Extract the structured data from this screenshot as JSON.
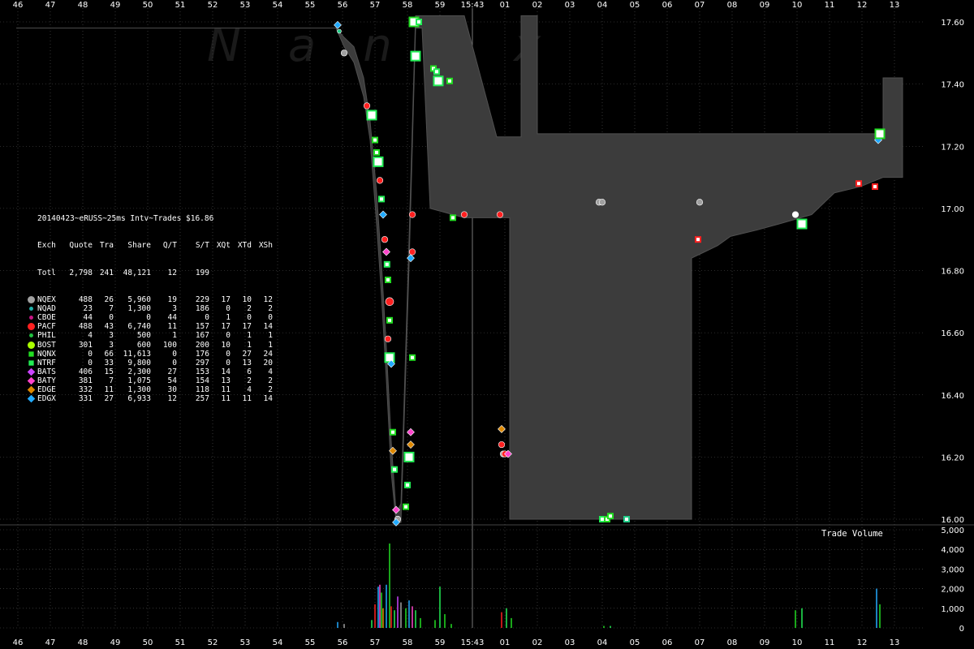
{
  "chart_data": {
    "type": "scatter",
    "title": "20140423~eRUSS~25ms Intv~Trades $16.86",
    "x_ticks_top": [
      "46",
      "47",
      "48",
      "49",
      "50",
      "51",
      "52",
      "53",
      "54",
      "55",
      "56",
      "57",
      "58",
      "59",
      "15:43",
      "01",
      "02",
      "03",
      "04",
      "05",
      "06",
      "07",
      "08",
      "09",
      "10",
      "11",
      "12",
      "13"
    ],
    "x_ticks_bottom": [
      "46",
      "47",
      "48",
      "49",
      "50",
      "51",
      "52",
      "53",
      "54",
      "55",
      "56",
      "57",
      "58",
      "59",
      "15:43",
      "01",
      "02",
      "03",
      "04",
      "05",
      "06",
      "07",
      "08",
      "09",
      "10",
      "11",
      "12",
      "13"
    ],
    "y_ticks": [
      "17.60",
      "17.40",
      "17.20",
      "17.00",
      "16.80",
      "16.60",
      "16.40",
      "16.20",
      "16.00"
    ],
    "ylim": [
      16.0,
      17.6
    ],
    "volume_ticks": [
      "5,000",
      "4,000",
      "3,000",
      "2,000",
      "1,000",
      "0"
    ],
    "volume_ylim": [
      0,
      5000
    ],
    "volume_title": "Trade Volume",
    "grid": true,
    "watermark": "Nanex",
    "legend": {
      "placement": "left",
      "header": [
        "Exch",
        "Quote",
        "Tra",
        "Share",
        "Q/T",
        "S/T",
        "XQt",
        "XTd",
        "XSh"
      ],
      "total": [
        "Totl",
        "2,798",
        "241",
        "48,121",
        "12",
        "199",
        "",
        "",
        ""
      ],
      "rows": [
        {
          "exch": "NQEX",
          "quote": "488",
          "tra": "26",
          "share": "5,960",
          "qt": "19",
          "st": "229",
          "xqt": "17",
          "xtd": "10",
          "xsh": "12",
          "color": "#a0a0a0",
          "shape": "circle-big"
        },
        {
          "exch": "NQAD",
          "quote": "23",
          "tra": "7",
          "share": "1,300",
          "qt": "3",
          "st": "186",
          "xqt": "0",
          "xtd": "2",
          "xsh": "2",
          "color": "#20b2aa",
          "shape": "dot"
        },
        {
          "exch": "CBOE",
          "quote": "44",
          "tra": "0",
          "share": "0",
          "qt": "44",
          "st": "0",
          "xqt": "1",
          "xtd": "0",
          "xsh": "0",
          "color": "#c71585",
          "shape": "dot"
        },
        {
          "exch": "PACF",
          "quote": "488",
          "tra": "43",
          "share": "6,740",
          "qt": "11",
          "st": "157",
          "xqt": "17",
          "xtd": "17",
          "xsh": "14",
          "color": "#ff2020",
          "shape": "circle-big"
        },
        {
          "exch": "PHIL",
          "quote": "4",
          "tra": "3",
          "share": "500",
          "qt": "1",
          "st": "167",
          "xqt": "0",
          "xtd": "1",
          "xsh": "1",
          "color": "#20c040",
          "shape": "dot"
        },
        {
          "exch": "BOST",
          "quote": "301",
          "tra": "3",
          "share": "600",
          "qt": "100",
          "st": "200",
          "xqt": "10",
          "xtd": "1",
          "xsh": "1",
          "color": "#aaff00",
          "shape": "circle-big"
        },
        {
          "exch": "NQNX",
          "quote": "0",
          "tra": "66",
          "share": "11,613",
          "qt": "0",
          "st": "176",
          "xqt": "0",
          "xtd": "27",
          "xsh": "24",
          "color": "#22dd22",
          "shape": "square"
        },
        {
          "exch": "NTRF",
          "quote": "0",
          "tra": "33",
          "share": "9,800",
          "qt": "0",
          "st": "297",
          "xqt": "0",
          "xtd": "13",
          "xsh": "20",
          "color": "#22ee55",
          "shape": "square"
        },
        {
          "exch": "BATS",
          "quote": "406",
          "tra": "15",
          "share": "2,300",
          "qt": "27",
          "st": "153",
          "xqt": "14",
          "xtd": "6",
          "xsh": "4",
          "color": "#cc44ff",
          "shape": "diamond"
        },
        {
          "exch": "BATY",
          "quote": "381",
          "tra": "7",
          "share": "1,075",
          "qt": "54",
          "st": "154",
          "xqt": "13",
          "xtd": "2",
          "xsh": "2",
          "color": "#ff44cc",
          "shape": "diamond"
        },
        {
          "exch": "EDGE",
          "quote": "332",
          "tra": "11",
          "share": "1,300",
          "qt": "30",
          "st": "118",
          "xqt": "11",
          "xtd": "4",
          "xsh": "2",
          "color": "#dd8800",
          "shape": "diamond"
        },
        {
          "exch": "EDGX",
          "quote": "331",
          "tra": "27",
          "share": "6,933",
          "qt": "12",
          "st": "257",
          "xqt": "11",
          "xtd": "11",
          "xsh": "14",
          "color": "#22aaff",
          "shape": "diamond"
        }
      ]
    },
    "nbbo_band": [
      {
        "t": 0.0,
        "bid": 17.58,
        "ask": 17.58
      },
      {
        "t": 9.85,
        "bid": 17.58,
        "ask": 17.58
      },
      {
        "t": 10.1,
        "bid": 17.52,
        "ask": 17.55
      },
      {
        "t": 10.4,
        "bid": 17.47,
        "ask": 17.52
      },
      {
        "t": 10.7,
        "bid": 17.36,
        "ask": 17.42
      },
      {
        "t": 10.9,
        "bid": 17.22,
        "ask": 17.28
      },
      {
        "t": 11.1,
        "bid": 16.95,
        "ask": 17.05
      },
      {
        "t": 11.25,
        "bid": 16.72,
        "ask": 16.82
      },
      {
        "t": 11.4,
        "bid": 16.45,
        "ask": 16.55
      },
      {
        "t": 11.55,
        "bid": 16.15,
        "ask": 16.25
      },
      {
        "t": 11.7,
        "bid": 15.99,
        "ask": 16.02
      },
      {
        "t": 11.85,
        "bid": 15.99,
        "ask": 16.05
      },
      {
        "t": 12.1,
        "bid": 16.82,
        "ask": 16.9
      },
      {
        "t": 12.3,
        "bid": 17.58,
        "ask": 17.62
      },
      {
        "t": 12.5,
        "bid": 17.58,
        "ask": 17.62
      },
      {
        "t": 12.75,
        "bid": 17.0,
        "ask": 17.62
      },
      {
        "t": 13.8,
        "bid": 16.97,
        "ask": 17.62
      },
      {
        "t": 14.8,
        "bid": 16.97,
        "ask": 17.23
      },
      {
        "t": 15.2,
        "bid": 16.97,
        "ask": 17.23
      },
      {
        "t": 15.2,
        "bid": 16.0,
        "ask": 17.23
      },
      {
        "t": 15.55,
        "bid": 16.0,
        "ask": 17.23
      },
      {
        "t": 15.55,
        "bid": 16.0,
        "ask": 17.62
      },
      {
        "t": 16.05,
        "bid": 16.0,
        "ask": 17.62
      },
      {
        "t": 16.05,
        "bid": 16.0,
        "ask": 17.24
      },
      {
        "t": 20.8,
        "bid": 16.0,
        "ask": 17.24
      },
      {
        "t": 20.8,
        "bid": 16.84,
        "ask": 17.24
      },
      {
        "t": 21.2,
        "bid": 16.86,
        "ask": 17.24
      },
      {
        "t": 21.6,
        "bid": 16.88,
        "ask": 17.24
      },
      {
        "t": 22.0,
        "bid": 16.91,
        "ask": 17.24
      },
      {
        "t": 22.8,
        "bid": 16.93,
        "ask": 17.24
      },
      {
        "t": 23.5,
        "bid": 16.95,
        "ask": 17.24
      },
      {
        "t": 24.5,
        "bid": 16.98,
        "ask": 17.24
      },
      {
        "t": 25.2,
        "bid": 17.05,
        "ask": 17.24
      },
      {
        "t": 26.0,
        "bid": 17.07,
        "ask": 17.24
      },
      {
        "t": 26.7,
        "bid": 17.1,
        "ask": 17.24
      },
      {
        "t": 26.7,
        "bid": 17.1,
        "ask": 17.42
      },
      {
        "t": 27.3,
        "bid": 17.1,
        "ask": 17.42
      }
    ],
    "trades": [
      {
        "x": 9.9,
        "y": 17.59,
        "c": "#22aaff",
        "s": "diamond"
      },
      {
        "x": 9.95,
        "y": 17.57,
        "c": "#22cc88",
        "s": "dot"
      },
      {
        "x": 10.1,
        "y": 17.5,
        "c": "#a0a0a0",
        "s": "circle"
      },
      {
        "x": 10.8,
        "y": 17.33,
        "c": "#ff2020",
        "s": "circle"
      },
      {
        "x": 10.95,
        "y": 17.3,
        "c": "#22ee55",
        "s": "square-big"
      },
      {
        "x": 11.05,
        "y": 17.22,
        "c": "#22dd22",
        "s": "square"
      },
      {
        "x": 11.1,
        "y": 17.18,
        "c": "#22dd22",
        "s": "square"
      },
      {
        "x": 11.15,
        "y": 17.15,
        "c": "#22ee55",
        "s": "square-big"
      },
      {
        "x": 11.2,
        "y": 17.09,
        "c": "#ff2020",
        "s": "circle"
      },
      {
        "x": 11.25,
        "y": 17.03,
        "c": "#22ee55",
        "s": "square"
      },
      {
        "x": 11.3,
        "y": 16.98,
        "c": "#22aaff",
        "s": "diamond"
      },
      {
        "x": 11.35,
        "y": 16.9,
        "c": "#ff2020",
        "s": "circle"
      },
      {
        "x": 11.4,
        "y": 16.86,
        "c": "#ff44cc",
        "s": "diamond"
      },
      {
        "x": 11.42,
        "y": 16.82,
        "c": "#22ee55",
        "s": "square"
      },
      {
        "x": 11.45,
        "y": 16.77,
        "c": "#22dd22",
        "s": "square"
      },
      {
        "x": 11.5,
        "y": 16.7,
        "c": "#ff2020",
        "s": "circle-big"
      },
      {
        "x": 11.5,
        "y": 16.64,
        "c": "#22dd22",
        "s": "square"
      },
      {
        "x": 11.45,
        "y": 16.58,
        "c": "#ff2020",
        "s": "circle"
      },
      {
        "x": 11.5,
        "y": 16.52,
        "c": "#22ee55",
        "s": "square-big"
      },
      {
        "x": 11.55,
        "y": 16.5,
        "c": "#22aaff",
        "s": "diamond"
      },
      {
        "x": 11.6,
        "y": 16.28,
        "c": "#22dd22",
        "s": "square"
      },
      {
        "x": 11.6,
        "y": 16.22,
        "c": "#dd8800",
        "s": "diamond"
      },
      {
        "x": 11.65,
        "y": 16.16,
        "c": "#22ee55",
        "s": "square"
      },
      {
        "x": 11.7,
        "y": 16.03,
        "c": "#ff44cc",
        "s": "diamond"
      },
      {
        "x": 11.75,
        "y": 16.0,
        "c": "#a0a0a0",
        "s": "circle"
      },
      {
        "x": 11.7,
        "y": 15.99,
        "c": "#22aaff",
        "s": "diamond"
      },
      {
        "x": 12.0,
        "y": 16.04,
        "c": "#22dd22",
        "s": "square"
      },
      {
        "x": 12.05,
        "y": 16.11,
        "c": "#22ee55",
        "s": "square"
      },
      {
        "x": 12.1,
        "y": 16.2,
        "c": "#22ee55",
        "s": "square-big"
      },
      {
        "x": 12.15,
        "y": 16.24,
        "c": "#dd8800",
        "s": "diamond"
      },
      {
        "x": 12.15,
        "y": 16.28,
        "c": "#ff44cc",
        "s": "diamond"
      },
      {
        "x": 12.2,
        "y": 16.52,
        "c": "#22dd22",
        "s": "square"
      },
      {
        "x": 12.15,
        "y": 16.84,
        "c": "#22aaff",
        "s": "diamond"
      },
      {
        "x": 12.2,
        "y": 16.86,
        "c": "#ff2020",
        "s": "circle"
      },
      {
        "x": 12.2,
        "y": 16.98,
        "c": "#ff2020",
        "s": "circle"
      },
      {
        "x": 12.3,
        "y": 17.49,
        "c": "#22ee55",
        "s": "square-big"
      },
      {
        "x": 12.25,
        "y": 17.6,
        "c": "#22dd22",
        "s": "square-big"
      },
      {
        "x": 12.4,
        "y": 17.6,
        "c": "#22ee55",
        "s": "square"
      },
      {
        "x": 12.85,
        "y": 17.45,
        "c": "#22dd22",
        "s": "square"
      },
      {
        "x": 12.95,
        "y": 17.44,
        "c": "#22ee55",
        "s": "square"
      },
      {
        "x": 13.0,
        "y": 17.41,
        "c": "#22ee55",
        "s": "square-big"
      },
      {
        "x": 13.35,
        "y": 17.41,
        "c": "#22dd22",
        "s": "square"
      },
      {
        "x": 13.45,
        "y": 16.97,
        "c": "#22dd22",
        "s": "square"
      },
      {
        "x": 13.8,
        "y": 16.98,
        "c": "#ff2020",
        "s": "circle"
      },
      {
        "x": 14.9,
        "y": 16.98,
        "c": "#ff2020",
        "s": "circle"
      },
      {
        "x": 14.95,
        "y": 16.29,
        "c": "#dd8800",
        "s": "diamond"
      },
      {
        "x": 14.95,
        "y": 16.24,
        "c": "#ff2020",
        "s": "circle"
      },
      {
        "x": 15.0,
        "y": 16.21,
        "c": "#a0a0a0",
        "s": "circle"
      },
      {
        "x": 15.05,
        "y": 16.21,
        "c": "#ff2020",
        "s": "circle"
      },
      {
        "x": 15.15,
        "y": 16.21,
        "c": "#ff44cc",
        "s": "diamond"
      },
      {
        "x": 18.05,
        "y": 16.0,
        "c": "#22ee55",
        "s": "square"
      },
      {
        "x": 18.2,
        "y": 16.0,
        "c": "#22dd22",
        "s": "square"
      },
      {
        "x": 18.3,
        "y": 16.01,
        "c": "#22dd22",
        "s": "square"
      },
      {
        "x": 18.8,
        "y": 16.0,
        "c": "#22cc88",
        "s": "square"
      },
      {
        "x": 17.95,
        "y": 17.02,
        "c": "#a0a0a0",
        "s": "circle"
      },
      {
        "x": 18.05,
        "y": 17.02,
        "c": "#a0a0a0",
        "s": "circle"
      },
      {
        "x": 21.05,
        "y": 17.02,
        "c": "#a0a0a0",
        "s": "circle"
      },
      {
        "x": 21.0,
        "y": 16.9,
        "c": "#ff2020",
        "s": "square"
      },
      {
        "x": 24.0,
        "y": 16.98,
        "c": "#ffffff",
        "s": "circle"
      },
      {
        "x": 24.2,
        "y": 16.95,
        "c": "#22ee55",
        "s": "square-big"
      },
      {
        "x": 25.95,
        "y": 17.08,
        "c": "#ff2020",
        "s": "square"
      },
      {
        "x": 26.45,
        "y": 17.07,
        "c": "#ff2020",
        "s": "square"
      },
      {
        "x": 26.55,
        "y": 17.22,
        "c": "#22aaff",
        "s": "diamond"
      },
      {
        "x": 26.6,
        "y": 17.24,
        "c": "#22dd22",
        "s": "square-big"
      }
    ],
    "volume_bars": [
      {
        "x": 9.9,
        "v": 300,
        "c": "#22aaff"
      },
      {
        "x": 10.1,
        "v": 200,
        "c": "#a0a0a0"
      },
      {
        "x": 10.95,
        "v": 400,
        "c": "#22ee55"
      },
      {
        "x": 11.05,
        "v": 1200,
        "c": "#ff2020"
      },
      {
        "x": 11.15,
        "v": 2100,
        "c": "#22aaff"
      },
      {
        "x": 11.2,
        "v": 2200,
        "c": "#ff44cc"
      },
      {
        "x": 11.25,
        "v": 1800,
        "c": "#22dd22"
      },
      {
        "x": 11.3,
        "v": 1000,
        "c": "#dd8800"
      },
      {
        "x": 11.4,
        "v": 2200,
        "c": "#22aaff"
      },
      {
        "x": 11.5,
        "v": 4300,
        "c": "#22dd22"
      },
      {
        "x": 11.55,
        "v": 1100,
        "c": "#ff2020"
      },
      {
        "x": 11.65,
        "v": 900,
        "c": "#22ee55"
      },
      {
        "x": 11.75,
        "v": 1600,
        "c": "#cc44ff"
      },
      {
        "x": 11.85,
        "v": 1300,
        "c": "#a0a0a0"
      },
      {
        "x": 12.0,
        "v": 1000,
        "c": "#22dd22"
      },
      {
        "x": 12.1,
        "v": 1400,
        "c": "#22aaff"
      },
      {
        "x": 12.2,
        "v": 1100,
        "c": "#ff44cc"
      },
      {
        "x": 12.3,
        "v": 900,
        "c": "#22ee55"
      },
      {
        "x": 12.45,
        "v": 500,
        "c": "#22dd22"
      },
      {
        "x": 12.9,
        "v": 400,
        "c": "#22dd22"
      },
      {
        "x": 13.05,
        "v": 2100,
        "c": "#22ee55"
      },
      {
        "x": 13.2,
        "v": 700,
        "c": "#22dd22"
      },
      {
        "x": 13.4,
        "v": 200,
        "c": "#22dd22"
      },
      {
        "x": 14.95,
        "v": 800,
        "c": "#ff2020"
      },
      {
        "x": 15.1,
        "v": 1000,
        "c": "#22ee55"
      },
      {
        "x": 15.25,
        "v": 500,
        "c": "#22dd22"
      },
      {
        "x": 18.1,
        "v": 100,
        "c": "#22dd22"
      },
      {
        "x": 18.3,
        "v": 100,
        "c": "#22ee55"
      },
      {
        "x": 24.0,
        "v": 900,
        "c": "#22dd22"
      },
      {
        "x": 24.2,
        "v": 1000,
        "c": "#22ee55"
      },
      {
        "x": 26.5,
        "v": 2000,
        "c": "#22aaff"
      },
      {
        "x": 26.6,
        "v": 1200,
        "c": "#22dd22"
      }
    ]
  },
  "colors": {
    "band": "#3c3c3c",
    "band_edge": "#505050",
    "background": "#000000",
    "grid": "#555555"
  }
}
